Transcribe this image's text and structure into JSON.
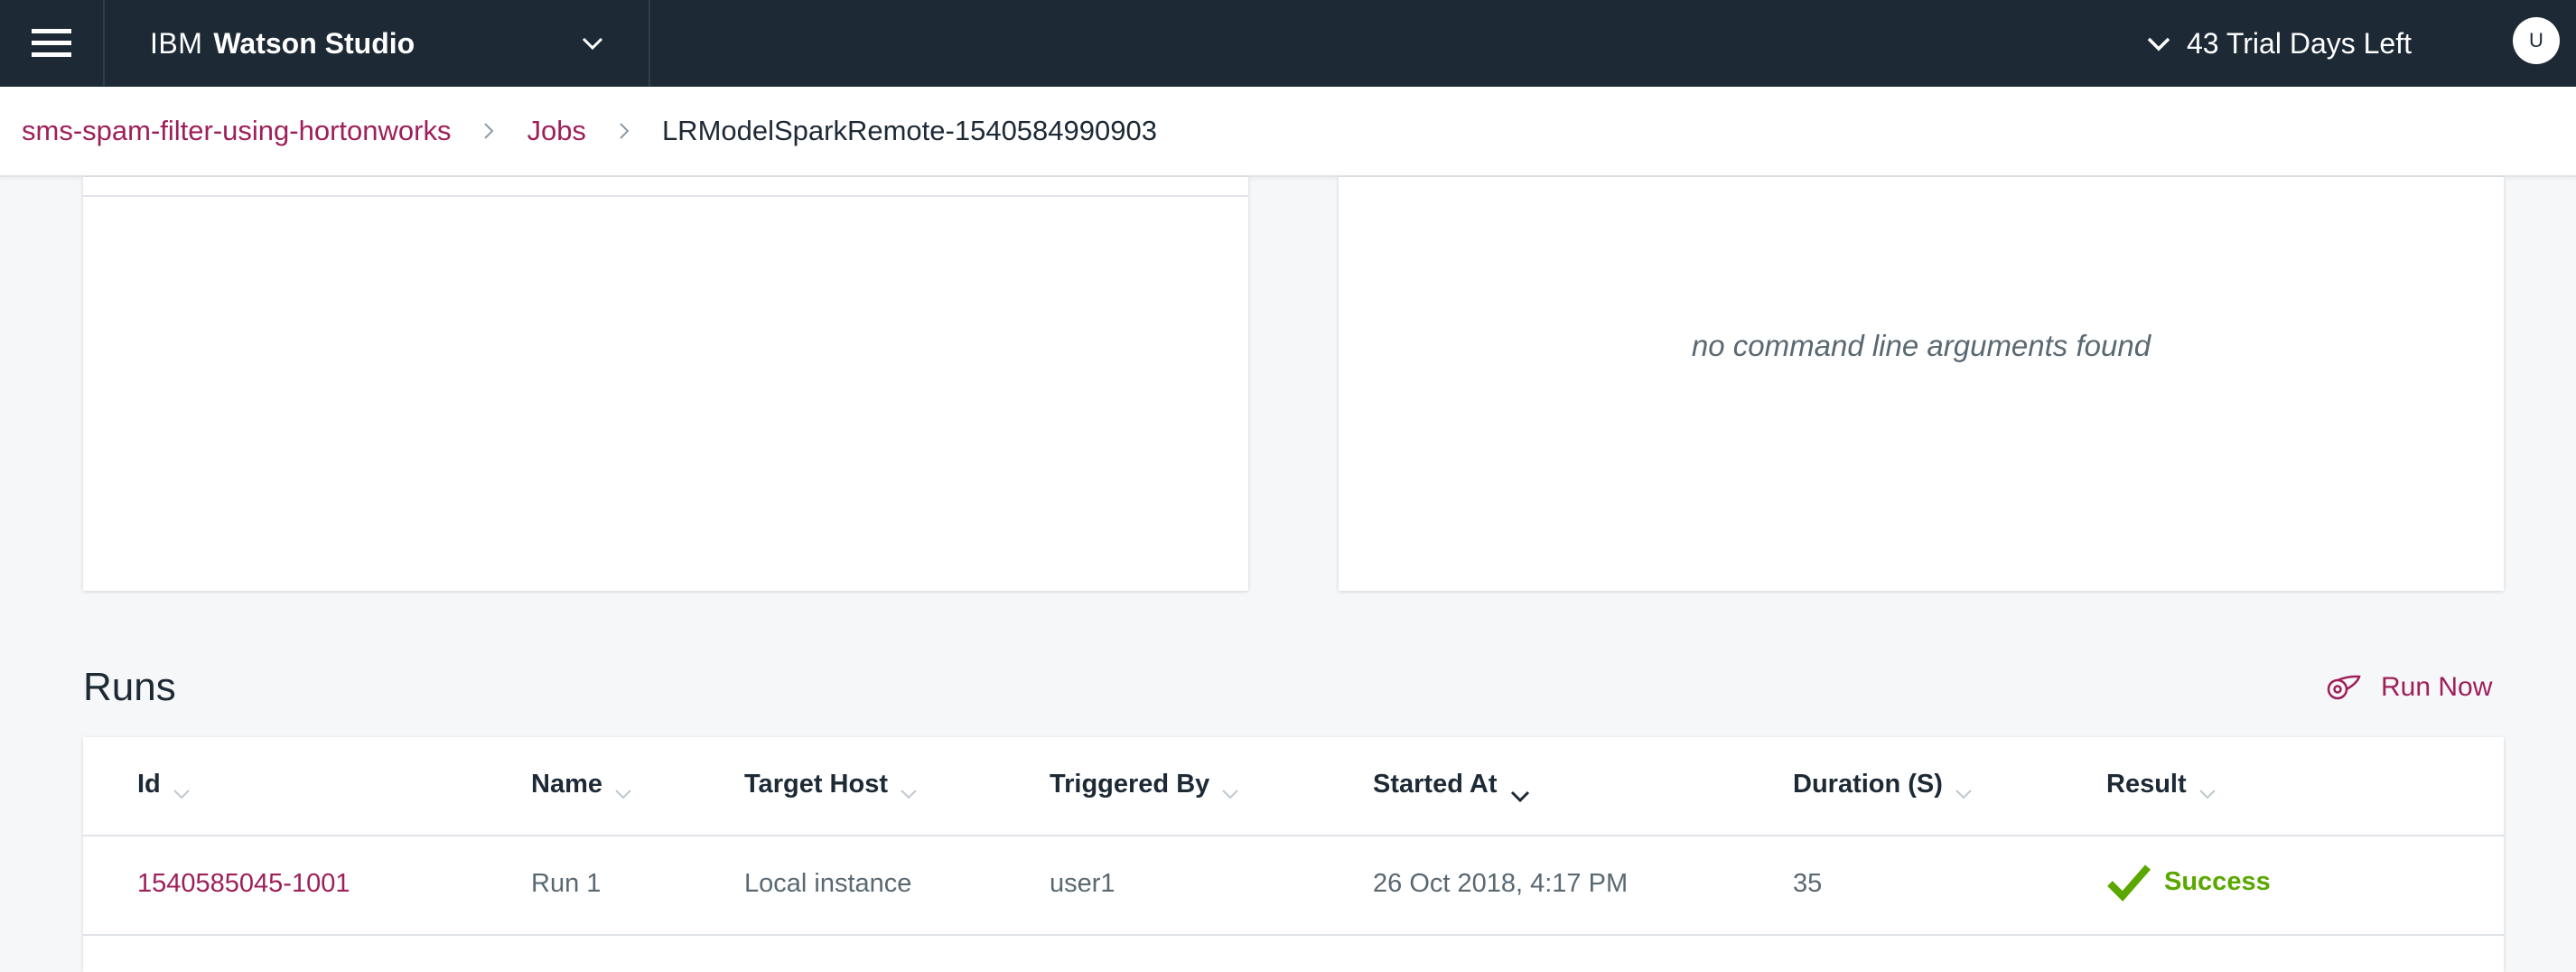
{
  "header": {
    "brand_ibm": "IBM",
    "brand_product": "Watson Studio",
    "trial_text": "43 Trial Days Left",
    "avatar_initial": "U"
  },
  "breadcrumb": {
    "items": [
      {
        "label": "sms-spam-filter-using-hortonworks"
      },
      {
        "label": "Jobs"
      }
    ],
    "current": "LRModelSparkRemote-1540584990903"
  },
  "arguments_panel": {
    "empty_text": "no command line arguments found"
  },
  "runs": {
    "title": "Runs",
    "run_now_label": "Run Now",
    "columns": [
      "Id",
      "Name",
      "Target Host",
      "Triggered By",
      "Started At",
      "Duration (S)",
      "Result"
    ],
    "sorted_column": "Started At",
    "rows": [
      {
        "id": "1540585045-1001",
        "name": "Run 1",
        "target_host": "Local instance",
        "triggered_by": "user1",
        "started_at": "26 Oct 2018, 4:17 PM",
        "duration": "35",
        "result": "Success"
      }
    ]
  },
  "colors": {
    "topbar": "#1d2a36",
    "link": "#9e1f5a",
    "success": "#5aa700",
    "background": "#f5f7f9"
  },
  "icons": {
    "menu": "hamburger-icon",
    "brand_dropdown": "chevron-down-icon",
    "trial_toggle": "chevron-down-icon",
    "breadcrumb_separator": "chevron-right-icon",
    "run_now": "run-icon",
    "sort": "chevron-down-icon",
    "success": "checkmark-icon"
  }
}
